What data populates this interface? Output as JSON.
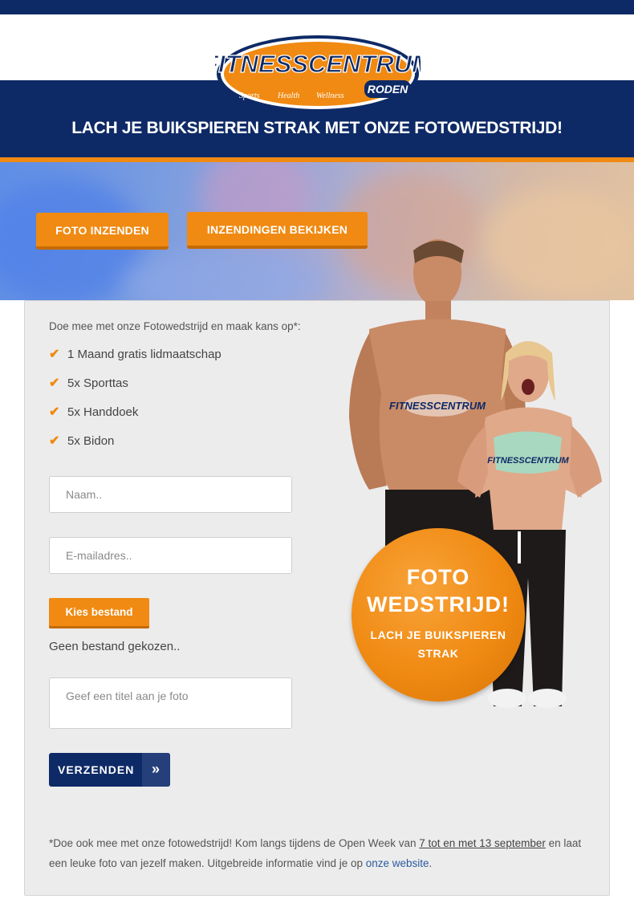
{
  "brand": {
    "logo_main": "FITNESSCENTRUM",
    "logo_sub": "RODEN",
    "logo_tagline": [
      "Sports",
      "Health",
      "Wellness"
    ],
    "color_navy": "#0e2a66",
    "color_orange": "#f08a12"
  },
  "header": {
    "headline": "LACH JE BUIKSPIEREN STRAK MET ONZE FOTOWEDSTRIJD!"
  },
  "hero": {
    "btn_submit": "FOTO INZENDEN",
    "btn_view": "INZENDINGEN BEKIJKEN"
  },
  "form": {
    "intro": "Doe mee met onze Fotowedstrijd en maak kans op*:",
    "prizes": [
      "1 Maand gratis lidmaatschap",
      "5x Sporttas",
      "5x Handdoek",
      "5x Bidon"
    ],
    "name_placeholder": "Naam..",
    "email_placeholder": "E-mailadres..",
    "file_button": "Kies bestand",
    "file_status": "Geen bestand gekozen..",
    "title_placeholder": "Geef een titel aan je foto",
    "submit_label": "VERZENDEN",
    "submit_icon": "double-chevron-right-icon"
  },
  "badge": {
    "line1": "FOTO",
    "line2": "WEDSTRIJD!",
    "line3": "LACH JE BUIKSPIEREN",
    "line4": "STRAK"
  },
  "footnote": {
    "part1": "*Doe ook mee met onze fotowedstrijd! Kom langs tijdens de Open Week van ",
    "dates": "7 tot en met 13 september",
    "part2": " en laat een leuke foto van jezelf maken. Uitgebreide informatie vind je op ",
    "link": "onze website",
    "part3": "."
  }
}
